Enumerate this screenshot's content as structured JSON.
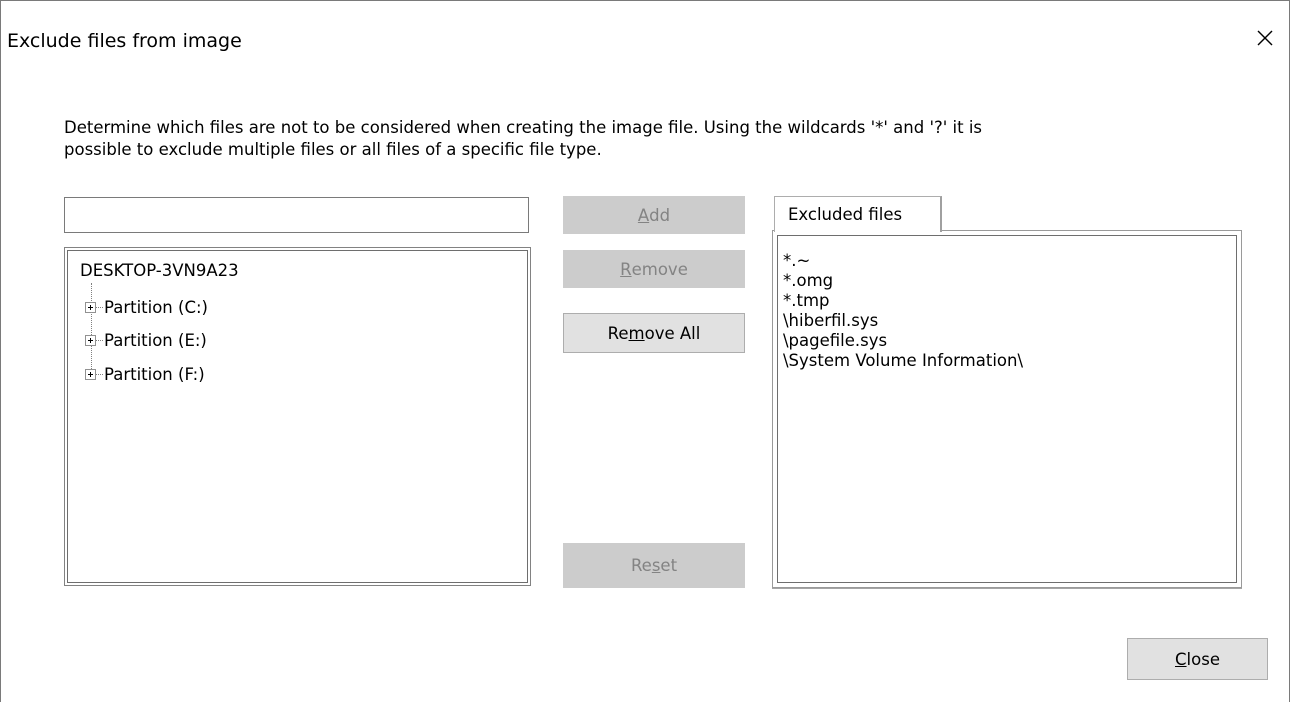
{
  "dialog": {
    "title": "Exclude files from image",
    "description_line1": "Determine which files are not to be considered when creating the image file. Using the wildcards '*' and '?' it is",
    "description_line2": "possible to exclude multiple files or all files of a specific file type."
  },
  "path_input": {
    "value": "",
    "placeholder": ""
  },
  "tree": {
    "root": "DESKTOP-3VN9A23",
    "nodes": [
      {
        "label": "Partition (C:)"
      },
      {
        "label": "Partition (E:)"
      },
      {
        "label": "Partition (F:)"
      }
    ]
  },
  "buttons": {
    "add_prefix": "",
    "add_mnemonic": "A",
    "add_suffix": "dd",
    "remove_prefix": "",
    "remove_mnemonic": "R",
    "remove_suffix": "emove",
    "remove_all_prefix": "Re",
    "remove_all_mnemonic": "m",
    "remove_all_suffix": "ove All",
    "reset_prefix": "Re",
    "reset_mnemonic": "s",
    "reset_suffix": "et",
    "close_prefix": "",
    "close_mnemonic": "C",
    "close_suffix": "lose"
  },
  "excluded": {
    "tab_label": "Excluded files",
    "items": [
      "*.~",
      "*.omg",
      "*.tmp",
      "\\hiberfil.sys",
      "\\pagefile.sys",
      "\\System Volume Information\\"
    ]
  },
  "icons": {
    "close": "close-icon",
    "expand": "plus-box-icon"
  },
  "colors": {
    "disabled_button_bg": "#cccccc",
    "disabled_button_text": "#838383",
    "enabled_button_bg": "#e1e1e1",
    "enabled_button_border": "#adadad"
  }
}
